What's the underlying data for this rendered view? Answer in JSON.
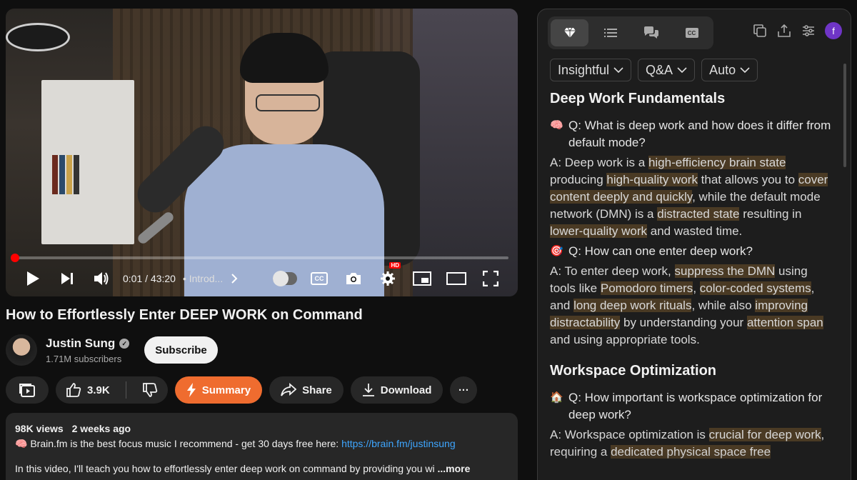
{
  "player": {
    "time": "0:01 / 43:20",
    "chapter": "• Introd...",
    "progress_fraction": 0.0004
  },
  "video": {
    "title": "How to Effortlessly Enter DEEP WORK on Command"
  },
  "channel": {
    "name": "Justin Sung",
    "subscribers": "1.71M subscribers",
    "subscribe_label": "Subscribe"
  },
  "actions": {
    "likes": "3.9K",
    "summary_label": "Summary",
    "share_label": "Share",
    "download_label": "Download",
    "more_label": "···"
  },
  "description": {
    "views": "98K views",
    "age": "2 weeks ago",
    "line1_prefix": "🧠 Brain.fm is the best focus music I recommend - get 30 days free here: ",
    "line1_link": "https://brain.fm/justinsung",
    "line2": "In this video, I'll teach you how to effortlessly enter deep work on command by providing you wi",
    "more": "...more"
  },
  "panel": {
    "user_initial": "f",
    "dropdowns": [
      "Insightful",
      "Q&A",
      "Auto"
    ],
    "sections": [
      {
        "title": "Deep Work Fundamentals",
        "items": [
          {
            "emoji": "🧠",
            "question": "Q: What is deep work and how does it differ from default mode?",
            "answer_parts": [
              {
                "t": "A: Deep work is a ",
                "h": false
              },
              {
                "t": "high-efficiency brain state",
                "h": true
              },
              {
                "t": " producing ",
                "h": false
              },
              {
                "t": "high-quality work",
                "h": true
              },
              {
                "t": " that allows you to ",
                "h": false
              },
              {
                "t": "cover content deeply and quickly",
                "h": true
              },
              {
                "t": ", while the default mode network (DMN) is a ",
                "h": false
              },
              {
                "t": "distracted state",
                "h": true
              },
              {
                "t": " resulting in ",
                "h": false
              },
              {
                "t": "lower-quality work",
                "h": true
              },
              {
                "t": " and wasted time.",
                "h": false
              }
            ]
          },
          {
            "emoji": "🎯",
            "question": "Q: How can one enter deep work?",
            "answer_parts": [
              {
                "t": "A: To enter deep work, ",
                "h": false
              },
              {
                "t": "suppress the DMN",
                "h": true
              },
              {
                "t": " using tools like ",
                "h": false
              },
              {
                "t": "Pomodoro timers",
                "h": true
              },
              {
                "t": ", ",
                "h": false
              },
              {
                "t": "color-coded systems",
                "h": true
              },
              {
                "t": ", and ",
                "h": false
              },
              {
                "t": "long deep work rituals",
                "h": true
              },
              {
                "t": ", while also ",
                "h": false
              },
              {
                "t": "improving distractability",
                "h": true
              },
              {
                "t": " by understanding your ",
                "h": false
              },
              {
                "t": "attention span",
                "h": true
              },
              {
                "t": " and using appropriate tools.",
                "h": false
              }
            ]
          }
        ]
      },
      {
        "title": "Workspace Optimization",
        "items": [
          {
            "emoji": "🏠",
            "question": "Q: How important is workspace optimization for deep work?",
            "answer_parts": [
              {
                "t": "A: Workspace optimization is ",
                "h": false
              },
              {
                "t": "crucial for deep work",
                "h": true
              },
              {
                "t": ", requiring a ",
                "h": false
              },
              {
                "t": "dedicated physical space free",
                "h": true
              }
            ]
          }
        ]
      }
    ]
  }
}
